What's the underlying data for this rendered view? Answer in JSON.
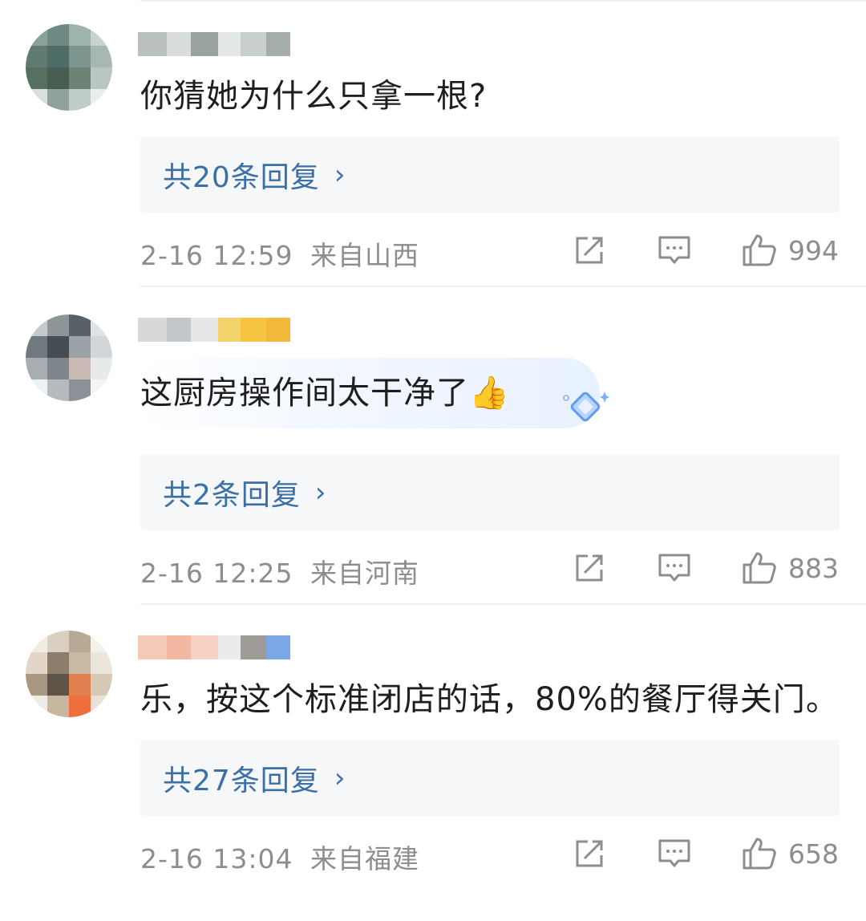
{
  "comments": [
    {
      "text": "你猜她为什么只拿一根?",
      "replies_label": "共20条回复",
      "chevron": "›",
      "timestamp": "2-16 12:59",
      "location": "来自山西",
      "likes": "994",
      "avatar_colors": [
        "#8aa09a",
        "#6f8a84",
        "#9fb3ad",
        "#c8d2cf",
        "#5e7a72",
        "#4f6d67",
        "#7c958f",
        "#a7b8b3",
        "#55705f",
        "#465f52",
        "#6b8274",
        "#b9c6c1",
        "#d8e0dd",
        "#8fa39a",
        "#c0ccc7",
        "#e9eeec"
      ],
      "username_colors": [
        "#b8bfbd",
        "#d9dedc",
        "#9aa3a0",
        "#e4e8e6",
        "#c9cfcd",
        "#a4adaa"
      ]
    },
    {
      "text": "这厨房操作间太干净了👍",
      "replies_label": "共2条回复",
      "chevron": "›",
      "timestamp": "2-16 12:25",
      "location": "来自河南",
      "likes": "883",
      "avatar_colors": [
        "#c6cacd",
        "#8e9599",
        "#5a6166",
        "#e0e2e3",
        "#6f7a80",
        "#454d52",
        "#9aa2a6",
        "#d2d6d8",
        "#a6aeb2",
        "#7d868b",
        "#c9b8b3",
        "#e7e9ea",
        "#eef0f1",
        "#b4babd",
        "#8a9297",
        "#f3f4f5"
      ],
      "username_colors": [
        "#d6d8da",
        "#c4c7c9",
        "#e4e6e7",
        "#f2d26b",
        "#f5c542",
        "#f0b93a"
      ]
    },
    {
      "text": "乐，按这个标准闭店的话，80%的餐厅得关门。",
      "replies_label": "共27条回复",
      "chevron": "›",
      "timestamp": "2-16 13:04",
      "location": "来自福建",
      "likes": "658",
      "avatar_colors": [
        "#f1ece4",
        "#d9cfc1",
        "#b7a996",
        "#f4f0ea",
        "#e2d6c6",
        "#8d7e6b",
        "#c9b9a3",
        "#ece5db",
        "#a89882",
        "#5d5347",
        "#e0804f",
        "#d6c8b4",
        "#f0ebe4",
        "#c7b7a1",
        "#ee6f3d",
        "#e8e1d7"
      ],
      "username_colors": [
        "#f4c9b8",
        "#f2b8a2",
        "#f7d2c4",
        "#ebebeb",
        "#9e9a96",
        "#7aa8e6"
      ]
    }
  ],
  "icons": {
    "share": "share-icon",
    "comment": "comment-icon",
    "like": "like-icon"
  }
}
